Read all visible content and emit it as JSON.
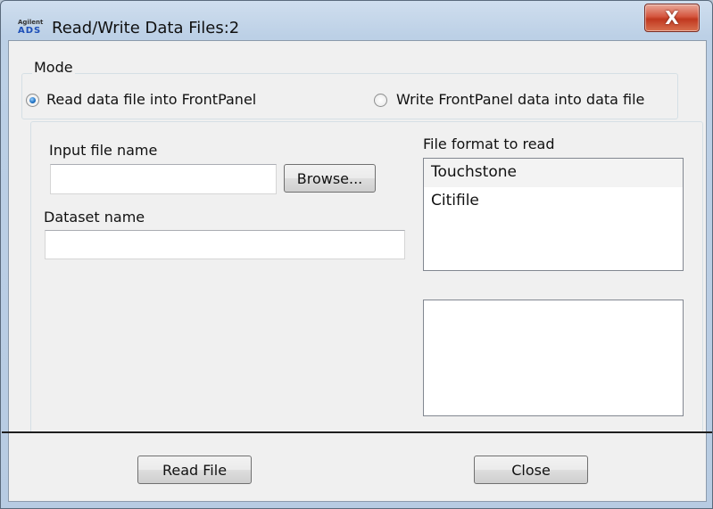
{
  "window": {
    "title": "Read/Write Data Files:2",
    "icon_top": "Agilent",
    "icon_bottom": "ADS",
    "close_glyph": "X"
  },
  "mode": {
    "legend": "Mode",
    "option_read": "Read data file into FrontPanel",
    "option_write": "Write FrontPanel data into data file",
    "selected": "read"
  },
  "input_file": {
    "label": "Input file name",
    "value": "",
    "browse_label": "Browse..."
  },
  "dataset": {
    "label": "Dataset name",
    "value": ""
  },
  "file_format": {
    "label": "File format to read",
    "options": [
      "Touchstone",
      "Citifile"
    ],
    "selected": "Touchstone"
  },
  "buttons": {
    "read_file": "Read File",
    "close": "Close"
  }
}
